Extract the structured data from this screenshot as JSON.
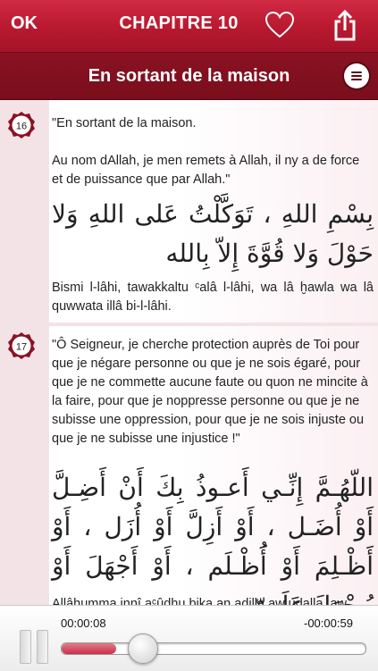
{
  "nav": {
    "ok_label": "OK",
    "title": "CHAPITRE 10",
    "favorite_icon": "heart-outline-icon",
    "share_icon": "share-icon"
  },
  "section": {
    "title": "En sortant de la maison",
    "menu_icon": "menu-icon"
  },
  "entries": [
    {
      "number": "16",
      "french": "\"En sortant de la maison.\n\nAu nom dAllah, je men remets à Allah, il ny a de force et de puissance que par Allah.\"",
      "arabic": "بِسْمِ اللهِ ، تَوَكَّلْتُ عَلى اللهِ وَلا حَوْلَ وَلا قُوَّةَ إِلاّ بِالله",
      "transliteration": "Bismi l-lâhi, tawakkaltu ᶜalâ l-lâhi, wa lâ ḫawla wa lâ quwwata illâ bi-l-lâhi."
    },
    {
      "number": "17",
      "french": "\"Ô Seigneur, je cherche protection auprès de Toi pour que je négare personne ou que je ne sois égaré, pour que je ne commette aucune faute ou quon ne mincite à la faire, pour que je noppresse personne ou que je ne subisse une oppression, pour que je ne sois injuste ou que je ne subisse une injustice !\"",
      "arabic": "اللّهُـمَّ إِنِّـي أَعـوذُ بِكَ أَنْ أَضِـلَّ أَوْ أُضَـل ، أَوْ أَزِلَّ أَوْ أُزَل ، أَوْ أَظْـلِمَ أَوْ أَُظْـلَم ، أَوْ أَجْهَلَ أَوْ يُـجْهَلَ عَلَـيّ",
      "transliteration": "Allâhumma innî aᶜûdhu bika an adilla aw udalla, aw"
    }
  ],
  "player": {
    "elapsed": "00:00:08",
    "remaining": "-00:00:59",
    "progress": 0.18,
    "pause_icon": "pause-icon"
  },
  "colors": {
    "nav_red": "#b8192f",
    "section_maroon": "#7a0e1c",
    "badge_red": "#8a1222"
  }
}
